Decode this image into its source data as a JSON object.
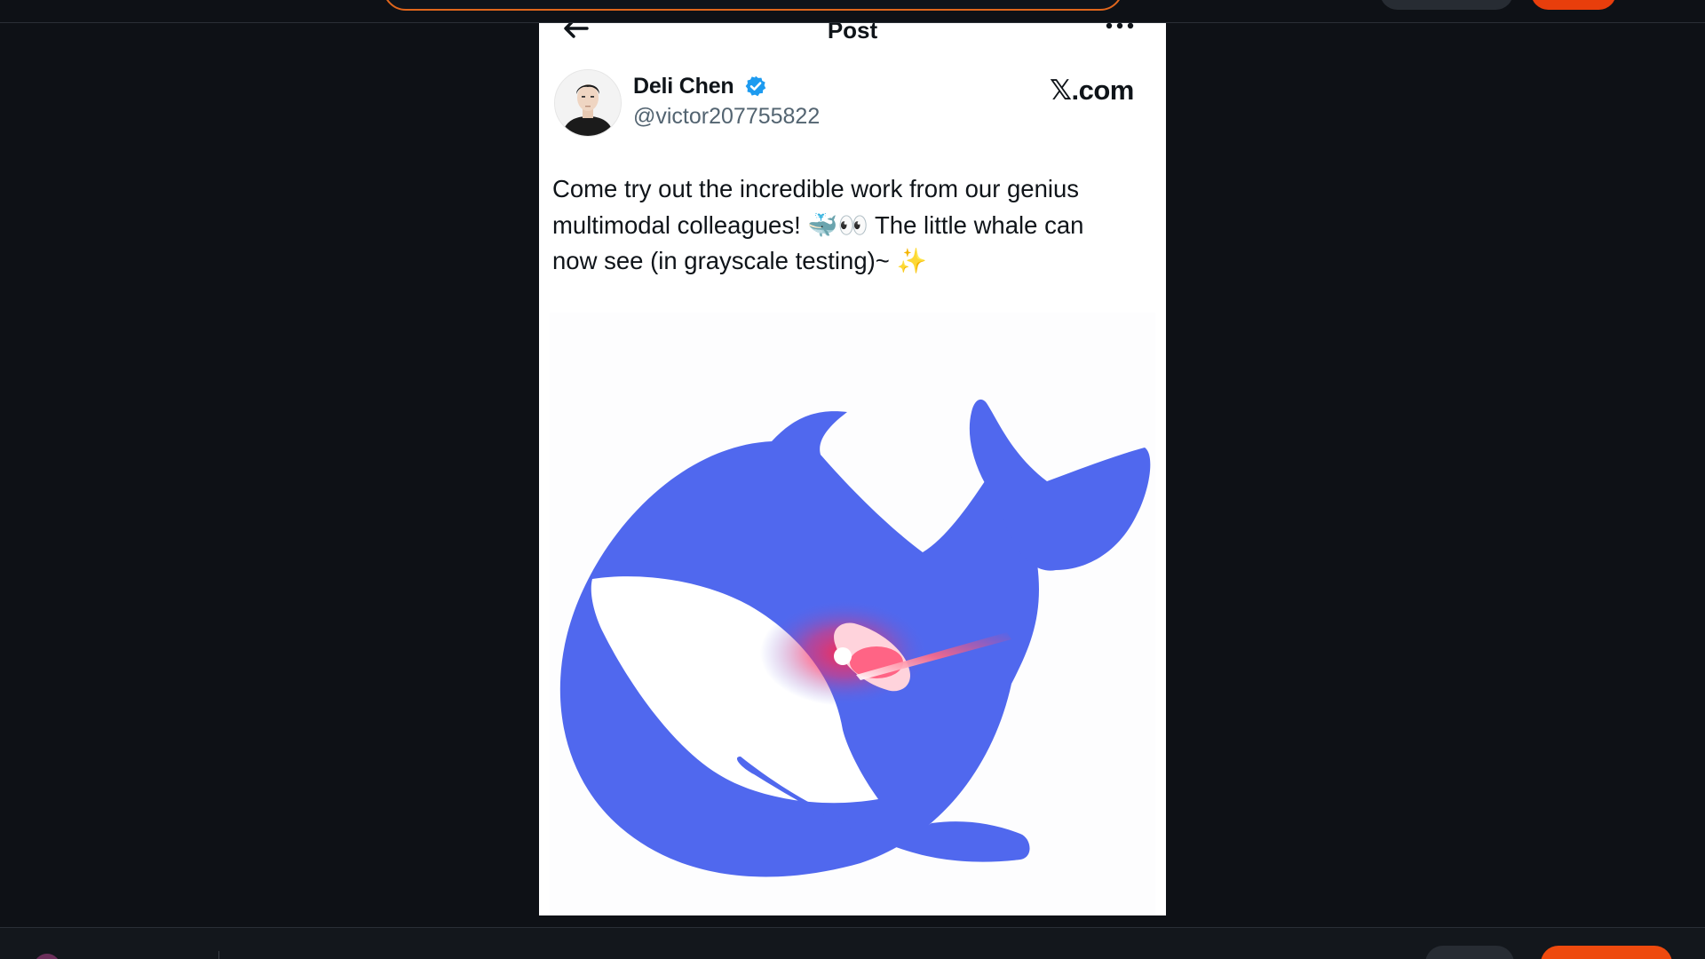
{
  "post": {
    "header_title": "Post",
    "author_name": "Deli Chen",
    "author_handle": "@victor207755822",
    "site_tag": "𝕏.com",
    "text_line1": "Come try out the incredible work from our genius",
    "text_line2_before": "multimodal colleagues! ",
    "text_line2_emoji": "🐳👀",
    "text_line2_after": " The little whale can",
    "text_line3_before": "now see (in grayscale testing)~ ",
    "text_line3_emoji": "✨"
  },
  "icons": {
    "back": "arrow-left-icon",
    "more": "more-horizontal-icon",
    "verified": "verified-badge-icon"
  },
  "colors": {
    "page_background": "#0e1116",
    "panel_background": "#ffffff",
    "whale_blue": "#5068ee",
    "verified_blue": "#1d9bf0",
    "accent_orange": "#e83e0c"
  }
}
